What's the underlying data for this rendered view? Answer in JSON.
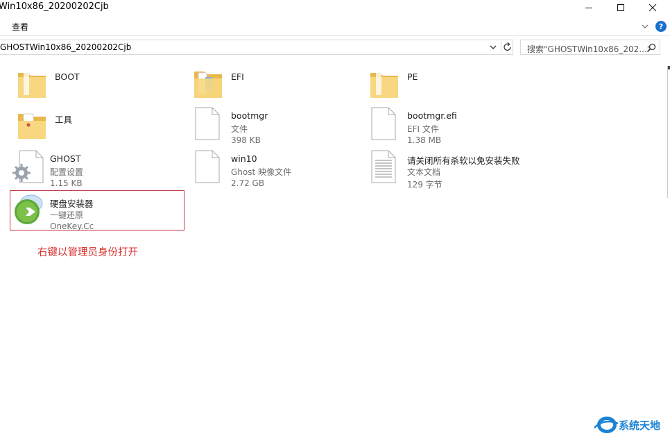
{
  "window": {
    "title": "Win10x86_20200202Cjb"
  },
  "ribbon": {
    "view_tab": "查看",
    "help_label": "?"
  },
  "address": {
    "path": "GHOSTWin10x86_20200202Cjb"
  },
  "search": {
    "placeholder": "搜索\"GHOSTWin10x86_202...\""
  },
  "items": [
    {
      "name": "BOOT",
      "type": "",
      "size": "",
      "icon": "folder-icon"
    },
    {
      "name": "EFI",
      "type": "",
      "size": "",
      "icon": "folder-documents-icon"
    },
    {
      "name": "PE",
      "type": "",
      "size": "",
      "icon": "folder-icon"
    },
    {
      "name": "工具",
      "type": "",
      "size": "",
      "icon": "folder-tools-icon"
    },
    {
      "name": "bootmgr",
      "type": "文件",
      "size": "398 KB",
      "icon": "blank-file-icon"
    },
    {
      "name": "bootmgr.efi",
      "type": "EFI 文件",
      "size": "1.38 MB",
      "icon": "blank-file-icon"
    },
    {
      "name": "GHOST",
      "type": "配置设置",
      "size": "1.15 KB",
      "icon": "config-settings-icon"
    },
    {
      "name": "win10",
      "type": "Ghost 映像文件",
      "size": "2.72 GB",
      "icon": "blank-file-icon"
    },
    {
      "name": "请关闭所有杀软以免安装失败",
      "type": "文本文档",
      "size": "129 字节",
      "icon": "text-document-icon"
    },
    {
      "name": "硬盘安装器",
      "type": "一键还原",
      "size": "OneKey.Cc",
      "icon": "onekey-installer-icon"
    }
  ],
  "annotation": "右键以管理员身份打开",
  "watermark": "系统天地",
  "colors": {
    "folder": "#f4d27a",
    "annotation_red": "#d8322f",
    "highlight_border": "#c53a4b",
    "help_blue": "#1a6fd1",
    "watermark_blue": "#1a83d6"
  }
}
